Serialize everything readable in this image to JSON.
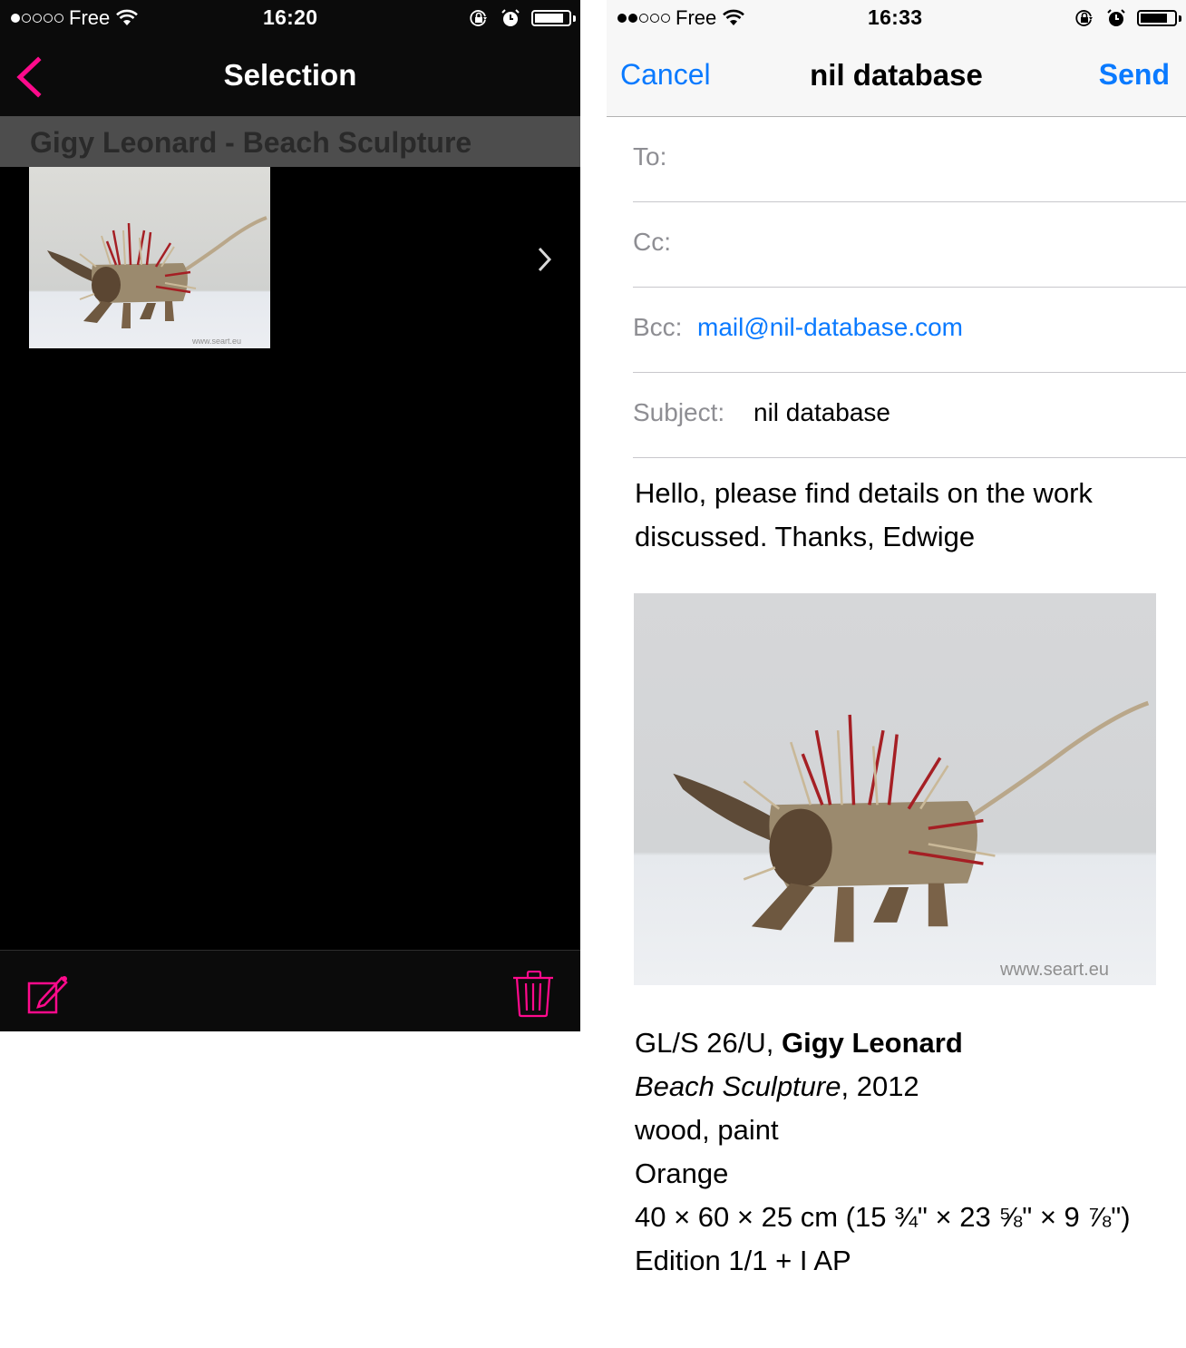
{
  "colors": {
    "accent_pink": "#ff0a8c",
    "ios_blue": "#0a7aff"
  },
  "left_screen": {
    "status": {
      "signal_dots_filled": 1,
      "signal_dots_total": 5,
      "carrier": "Free",
      "time": "16:20",
      "battery_level": 0.8
    },
    "nav": {
      "back_icon": "chevron-left-icon",
      "title": "Selection"
    },
    "section_header": "Gigy Leonard - Beach Sculpture",
    "item": {
      "thumbnail_alt": "Driftwood sculpture with red and natural spikes",
      "watermark": "www.seart.eu",
      "disclosure_icon": "chevron-right-icon"
    },
    "toolbar": {
      "compose_icon": "compose-icon",
      "trash_icon": "trash-icon"
    }
  },
  "right_screen": {
    "status": {
      "signal_dots_filled": 2,
      "signal_dots_total": 5,
      "carrier": "Free",
      "time": "16:33",
      "battery_level": 0.75
    },
    "nav": {
      "cancel_label": "Cancel",
      "title": "nil database",
      "send_label": "Send"
    },
    "fields": {
      "to_label": "To:",
      "to_value": "",
      "cc_label": "Cc:",
      "cc_value": "",
      "bcc_label": "Bcc:",
      "bcc_value": "mail@nil-database.com",
      "subject_label": "Subject:",
      "subject_value": "nil database"
    },
    "body": {
      "message": "Hello, please find details on the work discussed. Thanks, Edwige",
      "image_alt": "Driftwood sculpture with red and natural spikes",
      "image_watermark": "www.seart.eu",
      "details": {
        "reference": "GL/S 26/U, ",
        "artist": "Gigy Leonard",
        "title": "Beach Sculpture",
        "year": ", 2012",
        "medium": "wood, paint",
        "color": "Orange",
        "dimensions": "40 × 60 × 25 cm (15 ¾\" × 23 ⅝\" × 9 ⅞\")",
        "edition": "Edition 1/1 + I AP"
      }
    }
  }
}
